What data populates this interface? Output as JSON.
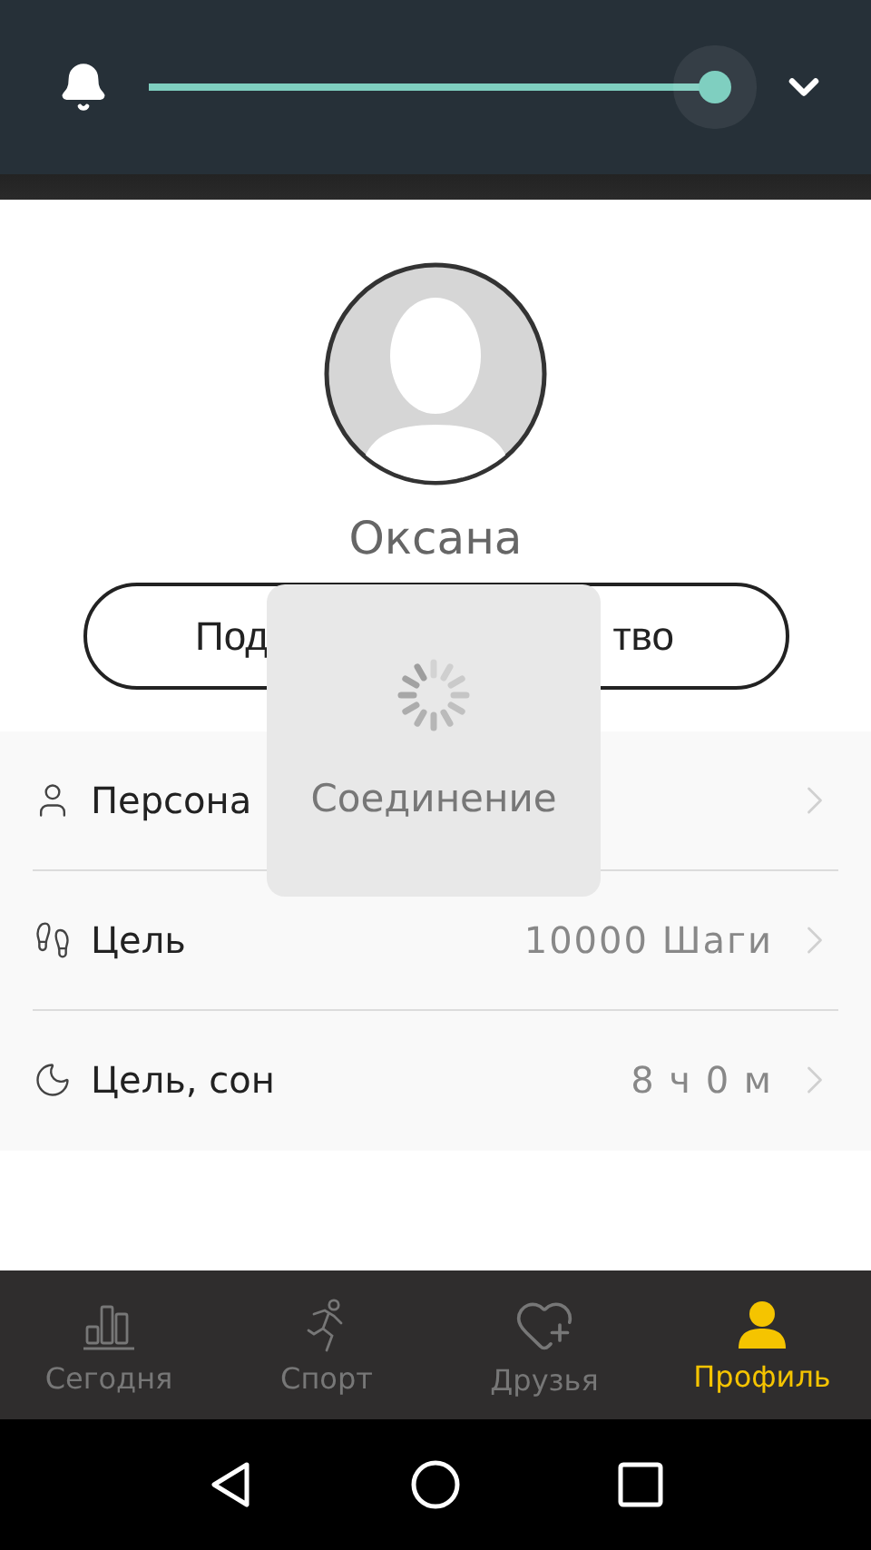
{
  "top_bar": {
    "slider": {
      "level": 1
    }
  },
  "profile": {
    "name": "Оксана",
    "connect_button": {
      "label_start": "Под",
      "label_end": "тво"
    }
  },
  "settings": [
    {
      "kind": "person",
      "label": "Персона"
    },
    {
      "kind": "steps",
      "label": "Цель",
      "value": "10000 Шаги"
    },
    {
      "kind": "sleep",
      "label": "Цель, сон",
      "value": "8 ч 0 м"
    }
  ],
  "loading_dialog": {
    "text": "Соединение"
  },
  "tabs": [
    {
      "kind": "today",
      "label": "Сегодня",
      "selected": false
    },
    {
      "kind": "sport",
      "label": "Спорт",
      "selected": false
    },
    {
      "kind": "friends",
      "label": "Друзья",
      "selected": false
    },
    {
      "kind": "profile",
      "label": "Профиль",
      "selected": true
    }
  ]
}
